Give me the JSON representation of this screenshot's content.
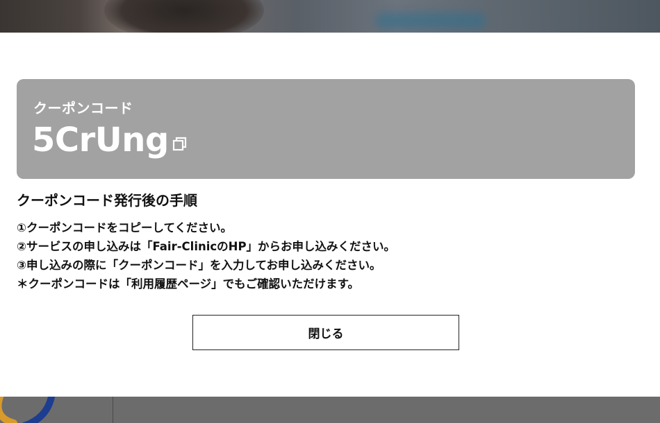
{
  "colors": {
    "coupon_box_bg": "#a2a2a2",
    "coupon_text": "#ffffff",
    "modal_bg": "#ffffff",
    "text": "#111111",
    "overlay_bottom": "#6c6c6c"
  },
  "coupon": {
    "label": "クーポンコード",
    "code": "5CrUng",
    "copy_icon": "copy-icon"
  },
  "steps": {
    "title": "クーポンコード発行後の手順",
    "items": [
      "①クーポンコードをコピーしてください。",
      "②サービスの申し込みは「Fair-ClinicのHP」からお申し込みください。",
      "③申し込みの際に「クーポンコード」を入力してお申し込みください。",
      "＊クーポンコードは「利用履歴ページ」でもご確認いただけます。"
    ]
  },
  "buttons": {
    "close_label": "閉じる"
  }
}
